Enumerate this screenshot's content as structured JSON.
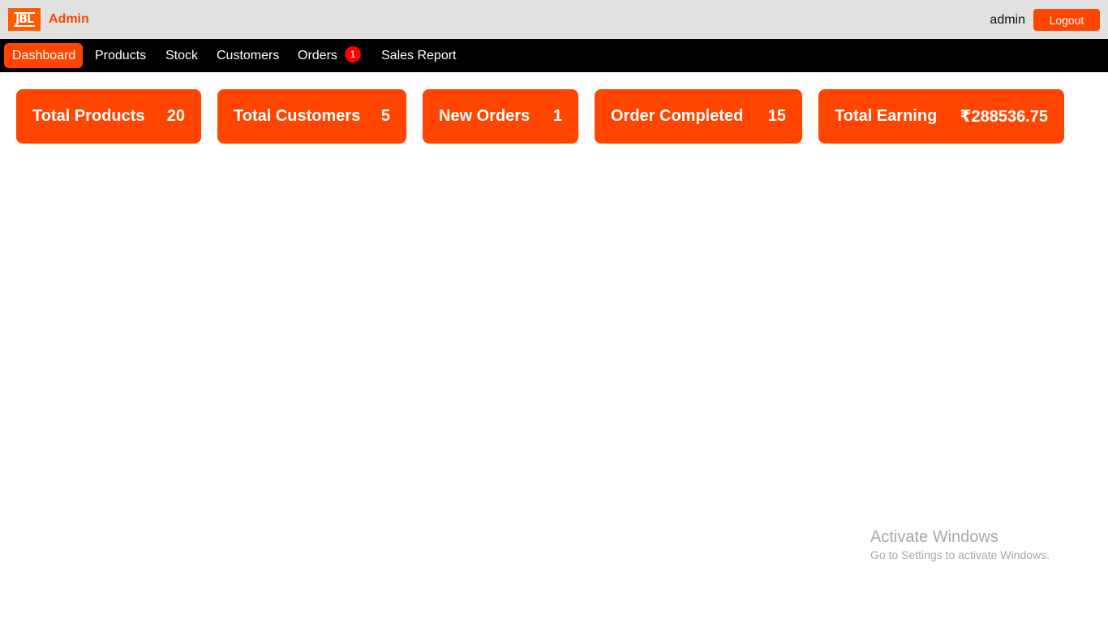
{
  "header": {
    "logo_text": "JBL",
    "app_title": "Admin",
    "username": "admin",
    "logout_label": "Logout"
  },
  "nav": {
    "items": [
      {
        "label": "Dashboard",
        "active": true
      },
      {
        "label": "Products"
      },
      {
        "label": "Stock"
      },
      {
        "label": "Customers"
      },
      {
        "label": "Orders",
        "badge": "1"
      },
      {
        "label": "Sales Report"
      }
    ]
  },
  "stats": [
    {
      "label": "Total Products",
      "value": "20"
    },
    {
      "label": "Total Customers",
      "value": "5"
    },
    {
      "label": "New Orders",
      "value": "1"
    },
    {
      "label": "Order Completed",
      "value": "15"
    },
    {
      "label": "Total Earning",
      "value": "₹288536.75"
    }
  ],
  "watermark": {
    "title": "Activate Windows",
    "subtitle": "Go to Settings to activate Windows."
  },
  "colors": {
    "accent": "#ff4500",
    "topbar_bg": "#e1e1e1",
    "navbar_bg": "#000000",
    "badge": "#ff0000"
  }
}
